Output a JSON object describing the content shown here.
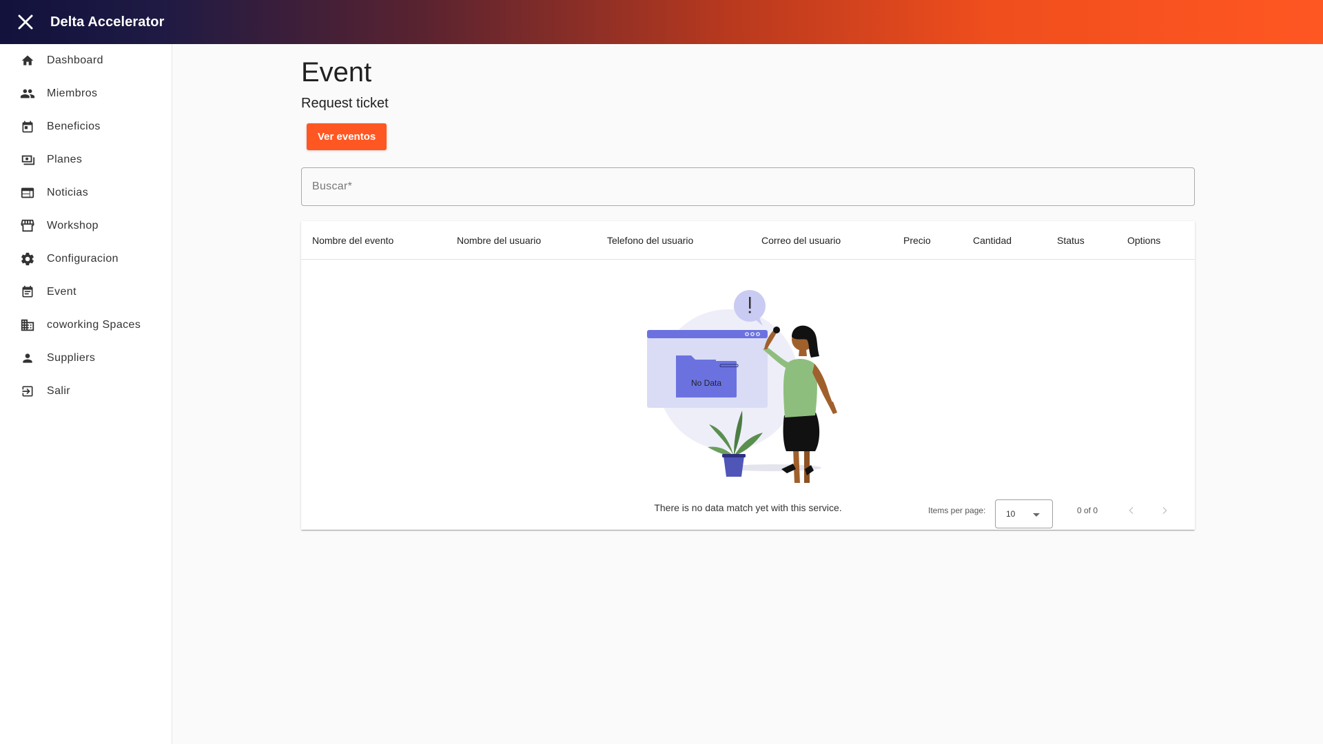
{
  "app": {
    "title": "Delta Accelerator"
  },
  "sidebar": {
    "items": [
      {
        "label": "Dashboard",
        "icon": "home-icon"
      },
      {
        "label": "Miembros",
        "icon": "people-icon"
      },
      {
        "label": "Beneficios",
        "icon": "calendar-icon"
      },
      {
        "label": "Planes",
        "icon": "money-icon"
      },
      {
        "label": "Noticias",
        "icon": "web-icon"
      },
      {
        "label": "Workshop",
        "icon": "storefront-icon"
      },
      {
        "label": "Configuracion",
        "icon": "gear-icon"
      },
      {
        "label": "Event",
        "icon": "event-note-icon"
      },
      {
        "label": "coworking Spaces",
        "icon": "business-icon"
      },
      {
        "label": "Suppliers",
        "icon": "person-icon"
      },
      {
        "label": "Salir",
        "icon": "exit-icon"
      }
    ]
  },
  "page": {
    "title": "Event",
    "subtitle": "Request ticket",
    "primary_button": "Ver eventos",
    "search_placeholder": "Buscar*"
  },
  "table": {
    "columns": [
      "Nombre del evento",
      "Nombre del usuario",
      "Telefono del usuario",
      "Correo del usuario",
      "Precio",
      "Cantidad",
      "Status",
      "Options"
    ],
    "rows": [],
    "empty_illustration_label": "No Data",
    "empty_message": "There is no data match yet with this service."
  },
  "paginator": {
    "items_per_page_label": "Items per page:",
    "items_per_page_value": "10",
    "range_label": "0 of 0"
  },
  "colors": {
    "accent": "#ff5722",
    "header_dark": "#12123d",
    "illustration_purple": "#6b72e0"
  }
}
